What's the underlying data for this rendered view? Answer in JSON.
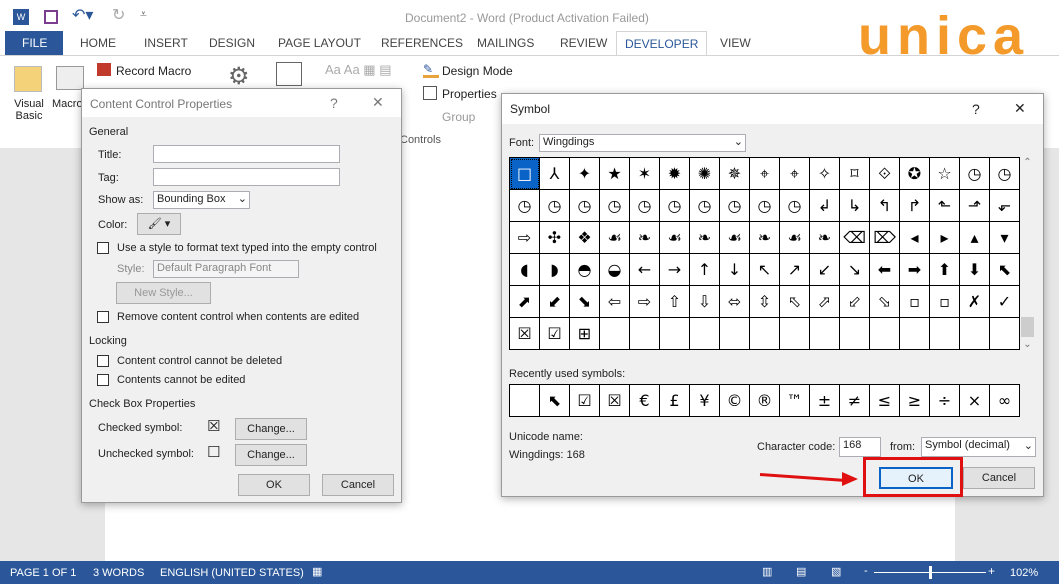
{
  "window": {
    "title": "Document2 - Word (Product Activation Failed)"
  },
  "tabs": [
    "FILE",
    "HOME",
    "INSERT",
    "DESIGN",
    "PAGE LAYOUT",
    "REFERENCES",
    "MAILINGS",
    "REVIEW",
    "DEVELOPER",
    "VIEW"
  ],
  "active_tab": "DEVELOPER",
  "ribbon": {
    "visual_basic": "Visual Basic",
    "macros": "Macros",
    "record_macro": "Record Macro",
    "design_mode": "Design Mode",
    "properties": "Properties",
    "group": "Group",
    "controls_label": "Controls"
  },
  "logo": "unica",
  "ccp": {
    "title": "Content Control Properties",
    "help": "?",
    "close": "✕",
    "general": "General",
    "title_label": "Title:",
    "title_value": "",
    "tag_label": "Tag:",
    "tag_value": "",
    "show_as_label": "Show as:",
    "show_as_value": "Bounding Box",
    "color_label": "Color:",
    "use_style": "Use a style to format text typed into the empty control",
    "style_label": "Style:",
    "style_value": "Default Paragraph Font",
    "new_style": "New Style...",
    "remove": "Remove content control when contents are edited",
    "locking": "Locking",
    "cannot_delete": "Content control cannot be deleted",
    "cannot_edit": "Contents cannot be edited",
    "checkbox_props": "Check Box Properties",
    "checked_label": "Checked symbol:",
    "checked_symbol": "☒",
    "unchecked_label": "Unchecked symbol:",
    "unchecked_symbol": "☐",
    "change": "Change...",
    "ok": "OK",
    "cancel": "Cancel"
  },
  "symbol": {
    "title": "Symbol",
    "help": "?",
    "close": "✕",
    "font_label": "Font:",
    "font_value": "Wingdings",
    "grid": [
      "□",
      "⅄",
      "✦",
      "★",
      "✶",
      "✹",
      "✺",
      "✵",
      "⌖",
      "⌖",
      "✧",
      "⌑",
      "⟐",
      "✪",
      "☆",
      "◷",
      "◷",
      "◷",
      "◷",
      "◷",
      "◷",
      "◷",
      "◷",
      "◷",
      "◷",
      "◷",
      "◷",
      "↲",
      "↳",
      "↰",
      "↱",
      "⬑",
      "⬏",
      "⬐",
      "⇨",
      "✣",
      "❖",
      "☙",
      "❧",
      "☙",
      "❧",
      "☙",
      "❧",
      "☙",
      "❧",
      "⌫",
      "⌦",
      "◂",
      "▸",
      "▴",
      "▾",
      "◖",
      "◗",
      "◓",
      "◒",
      "←",
      "→",
      "↑",
      "↓",
      "↖",
      "↗",
      "↙",
      "↘",
      "⬅",
      "➡",
      "⬆",
      "⬇",
      "⬉",
      "⬈",
      "⬋",
      "⬊",
      "⇦",
      "⇨",
      "⇧",
      "⇩",
      "⬄",
      "⇳",
      "⬁",
      "⬀",
      "⬃",
      "⬂",
      "▫",
      "▫",
      "✗",
      "✓",
      "☒",
      "☑",
      "⊞",
      "",
      "",
      "",
      "",
      "",
      "",
      "",
      "",
      "",
      "",
      "",
      "",
      "",
      ""
    ],
    "recent_label": "Recently used symbols:",
    "recent": [
      "",
      "⬉",
      "☑",
      "☒",
      "€",
      "£",
      "¥",
      "©",
      "®",
      "™",
      "±",
      "≠",
      "≤",
      "≥",
      "÷",
      "×",
      "∞"
    ],
    "unicode_name_label": "Unicode name:",
    "unicode_name_value": "Wingdings: 168",
    "char_code_label": "Character code:",
    "char_code_value": "168",
    "from_label": "from:",
    "from_value": "Symbol (decimal)",
    "ok": "OK",
    "cancel": "Cancel"
  },
  "status": {
    "page": "PAGE 1 OF 1",
    "words": "3 WORDS",
    "language": "ENGLISH (UNITED STATES)",
    "zoom": "102%"
  },
  "colors": {
    "accent": "#2b579a",
    "selection": "#0a64c8",
    "highlight": "#e01010",
    "logo": "#f39a2b"
  }
}
